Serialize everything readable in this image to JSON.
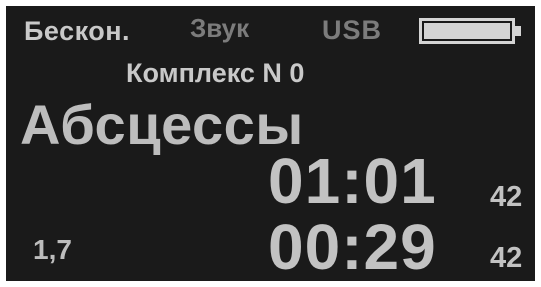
{
  "status_bar": {
    "mode": "Бескон.",
    "sound": "Звук",
    "usb": "USB",
    "battery_icon": "battery-icon",
    "battery_level": 1.0
  },
  "complex": {
    "label": "Комплекс N 0"
  },
  "exercise": {
    "title": "Абсцессы"
  },
  "timers": {
    "main": "01:01",
    "main_fraction": "42",
    "sub": "00:29",
    "sub_fraction": "42"
  },
  "ratio": {
    "value": "1,7"
  },
  "colors": {
    "background": "#1a1a1a",
    "text": "#bdbdbd",
    "dim_text": "#7c7c7c"
  }
}
